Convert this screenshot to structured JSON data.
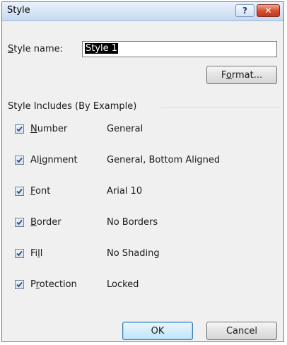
{
  "window": {
    "title": "Style",
    "help_glyph": "?",
    "close_glyph": "✕"
  },
  "style_name": {
    "label_underlined": "S",
    "label_rest": "tyle name:",
    "value": "Style 1"
  },
  "format_button": {
    "before": "F",
    "underlined": "o",
    "after": "rmat..."
  },
  "group": {
    "title": "Style Includes (By Example)"
  },
  "options": [
    {
      "pre": "",
      "u": "N",
      "post": "umber",
      "value": "General",
      "checked": true
    },
    {
      "pre": "Al",
      "u": "i",
      "post": "gnment",
      "value": "General, Bottom Aligned",
      "checked": true
    },
    {
      "pre": "",
      "u": "F",
      "post": "ont",
      "value": "Arial 10",
      "checked": true
    },
    {
      "pre": "",
      "u": "B",
      "post": "order",
      "value": "No Borders",
      "checked": true
    },
    {
      "pre": "Fi",
      "u": "l",
      "post": "l",
      "value": "No Shading",
      "checked": true
    },
    {
      "pre": "P",
      "u": "r",
      "post": "otection",
      "value": "Locked",
      "checked": true
    }
  ],
  "buttons": {
    "ok": "OK",
    "cancel": "Cancel"
  },
  "colors": {
    "check": "#2b4a7d",
    "close_bg": "#c8432a"
  }
}
